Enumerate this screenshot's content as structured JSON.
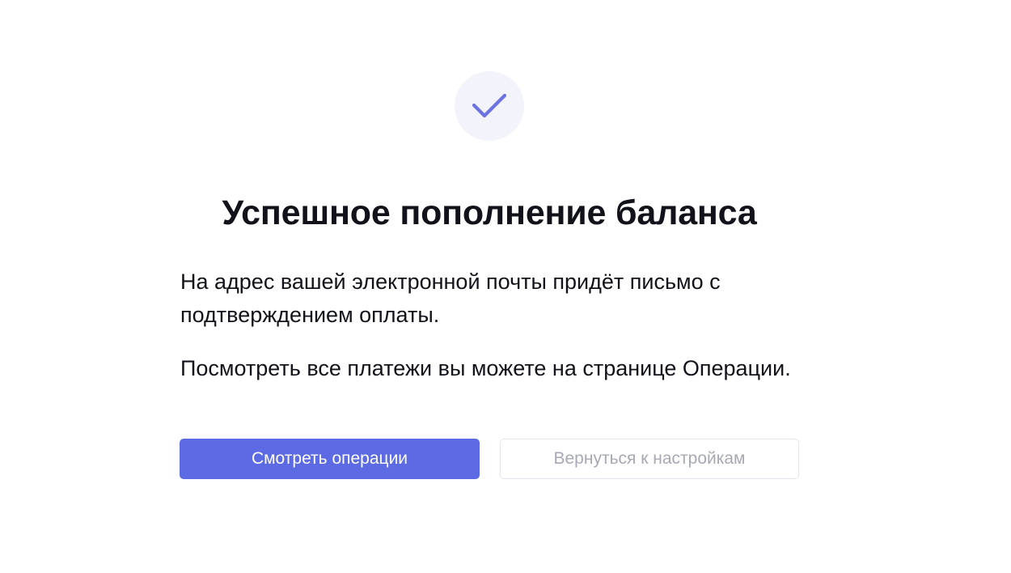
{
  "colors": {
    "accent": "#5c6ae4",
    "icon_circle_bg": "#f3f4fb",
    "text": "#12131a",
    "secondary_text": "#a7a9b4",
    "secondary_border": "#e4e5ec"
  },
  "icon": {
    "name": "checkmark-icon"
  },
  "title": "Успешное пополнение баланса",
  "paragraphs": {
    "email_notice": "На адрес вашей электронной почты придёт письмо с подтверждением оплаты.",
    "operations_notice": "Посмотреть все платежи вы можете на странице Операции."
  },
  "buttons": {
    "view_operations": "Смотреть операции",
    "back_to_settings": "Вернуться к настройкам"
  }
}
